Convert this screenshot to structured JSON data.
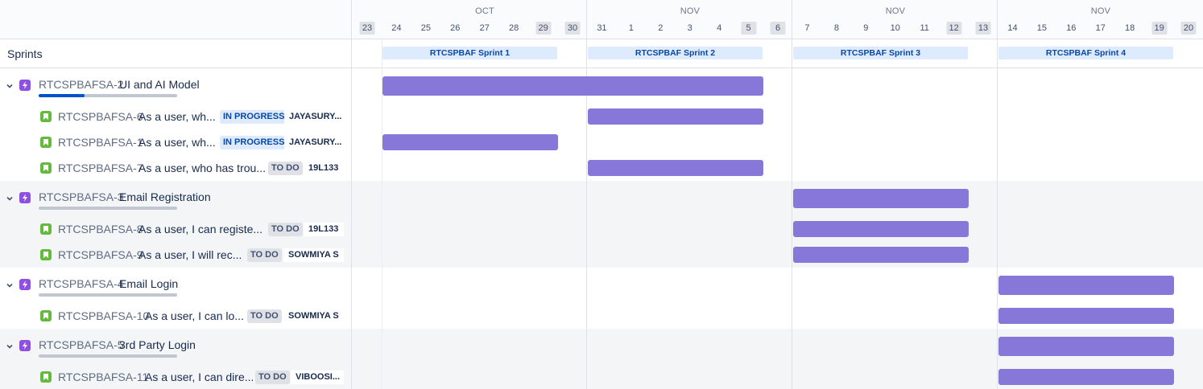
{
  "timeline": {
    "months": [
      "OCT",
      "NOV",
      "NOV",
      "NOV"
    ],
    "days": [
      "23",
      "24",
      "25",
      "26",
      "27",
      "28",
      "29",
      "30",
      "31",
      "1",
      "2",
      "3",
      "4",
      "5",
      "6",
      "7",
      "8",
      "9",
      "10",
      "11",
      "12",
      "13",
      "14",
      "15",
      "16",
      "17",
      "18",
      "19",
      "20"
    ],
    "weekend_days": [
      "23",
      "29",
      "30",
      "5",
      "6",
      "12",
      "13",
      "19",
      "20"
    ]
  },
  "sprints_label": "Sprints",
  "sprints": [
    {
      "name": "RTCSPBAF Sprint 1"
    },
    {
      "name": "RTCSPBAF Sprint 2"
    },
    {
      "name": "RTCSPBAF Sprint 3"
    },
    {
      "name": "RTCSPBAF Sprint 4"
    }
  ],
  "epics": [
    {
      "key": "RTCSPBAFSA-2",
      "title": "UI and AI Model",
      "progress": 0.33,
      "stories": [
        {
          "key": "RTCSPBAFSA-6",
          "title": "As a user, wh...",
          "status": "IN PROGRESS",
          "assignee": "JAYASURY..."
        },
        {
          "key": "RTCSPBAFSA-1",
          "title": "As a user, wh...",
          "status": "IN PROGRESS",
          "assignee": "JAYASURY..."
        },
        {
          "key": "RTCSPBAFSA-7",
          "title": "As a user, who has trou...",
          "status": "TO DO",
          "assignee": "19L133"
        }
      ]
    },
    {
      "key": "RTCSPBAFSA-3",
      "title": "Email Registration",
      "progress": 0,
      "stories": [
        {
          "key": "RTCSPBAFSA-8",
          "title": "As a user, I can registe...",
          "status": "TO DO",
          "assignee": "19L133"
        },
        {
          "key": "RTCSPBAFSA-9",
          "title": "As a user, I will rec...",
          "status": "TO DO",
          "assignee": "SOWMIYA S"
        }
      ]
    },
    {
      "key": "RTCSPBAFSA-4",
      "title": "Email Login",
      "progress": 0,
      "stories": [
        {
          "key": "RTCSPBAFSA-10",
          "title": "As a user, I can lo...",
          "status": "TO DO",
          "assignee": "SOWMIYA S"
        }
      ]
    },
    {
      "key": "RTCSPBAFSA-5",
      "title": "3rd Party Login",
      "progress": 0,
      "stories": [
        {
          "key": "RTCSPBAFSA-11",
          "title": "As a user, I can dire...",
          "status": "TO DO",
          "assignee": "VIBOOSI..."
        }
      ]
    }
  ],
  "colors": {
    "bar": "#8777d9",
    "epic_icon": "#904ee2",
    "story_icon": "#63ba3c",
    "progress": "#0052cc"
  },
  "icons": {
    "expand": "chevron-down-icon",
    "epic": "lightning-icon",
    "story": "bookmark-icon"
  }
}
